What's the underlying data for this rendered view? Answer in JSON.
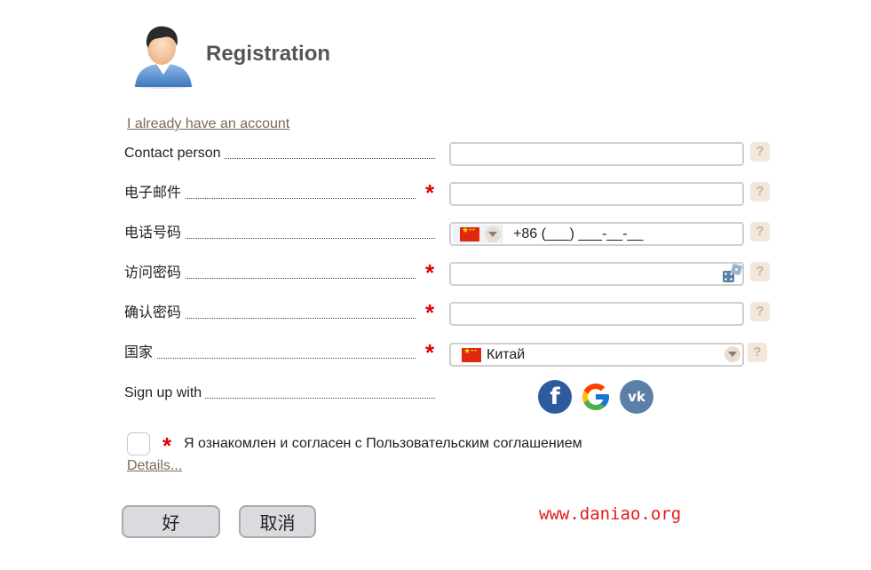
{
  "header": {
    "title": "Registration"
  },
  "links": {
    "login": "I already have an account",
    "details": "Details..."
  },
  "fields": [
    {
      "label": "Contact person",
      "value": "",
      "required": false
    },
    {
      "label": "电子邮件",
      "value": "",
      "required": true
    },
    {
      "label": "电话号码",
      "value": "+86 (___) ___-__-__",
      "required": false
    },
    {
      "label": "访问密码",
      "value": "",
      "required": true
    },
    {
      "label": "确认密码",
      "value": "",
      "required": true
    },
    {
      "label": "国家",
      "value": "Китай",
      "required": true
    },
    {
      "label": "Sign up with"
    }
  ],
  "required_mark": "*",
  "help_mark": "?",
  "social": {
    "facebook": "f",
    "vk": "vk"
  },
  "agreement": {
    "text": "Я ознакомлен и согласен с Пользовательским соглашением",
    "checked": false
  },
  "buttons": {
    "ok": "好",
    "cancel": "取消"
  },
  "watermark": "www.daniao.org",
  "colors": {
    "required": "#e00000",
    "link": "#7a6a55",
    "watermark": "#e31b1b",
    "button_bg": "#d9dbde",
    "help_bg": "#f3e6da"
  },
  "icons": {
    "avatar": "user-avatar-icon",
    "flag": "china-flag-icon",
    "password_generator": "dice-icon",
    "dropdown": "chevron-down-icon"
  }
}
